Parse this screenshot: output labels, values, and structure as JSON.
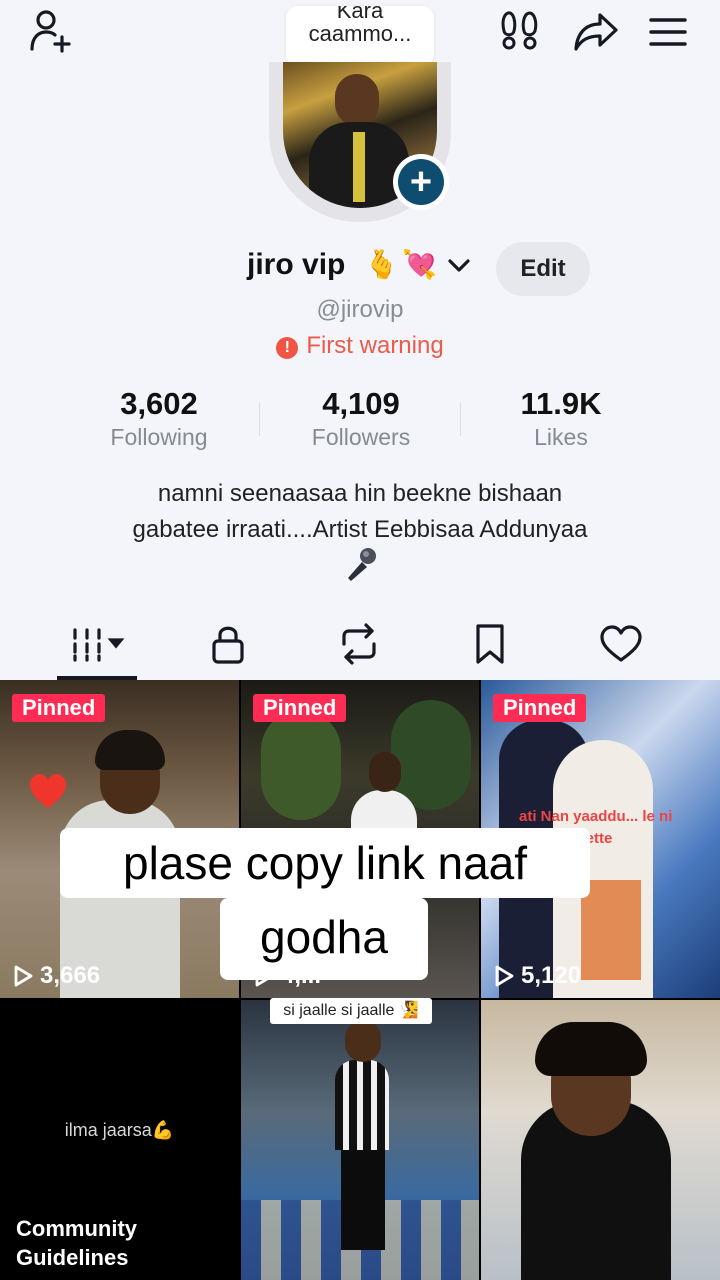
{
  "topbar": {
    "icons": [
      "add-friend-icon",
      "footprints-icon",
      "share-icon",
      "menu-icon"
    ]
  },
  "note": {
    "line1": "Kara",
    "line2": "caammo..."
  },
  "profile": {
    "name": "jiro vip",
    "emoji_hand": "🫰",
    "emoji_heart": "💘",
    "edit_label": "Edit",
    "handle": "@jirovip",
    "warning": "First warning",
    "warning_icon": "!",
    "bio_line1": "namni seenaasaa hin beekne bishaan",
    "bio_line2": "gabatee irraati....Artist Eebbisaa Addunyaa",
    "bio_emoji": "microphone-icon"
  },
  "stats": [
    {
      "value": "3,602",
      "label": "Following"
    },
    {
      "value": "4,109",
      "label": "Followers"
    },
    {
      "value": "11.9K",
      "label": "Likes"
    }
  ],
  "tabs": [
    "videos-grid-icon",
    "lock-icon",
    "repost-icon",
    "bookmark-icon",
    "heart-outline-icon"
  ],
  "videos": [
    {
      "pinned": "Pinned",
      "views": "3,666"
    },
    {
      "pinned": "Pinned",
      "views": "4,..."
    },
    {
      "pinned": "Pinned",
      "views": "5,120",
      "caption": "ati Nan yaaddu... le ni dhuffa ...jette"
    },
    {
      "text": "ilma jaarsa💪",
      "footer_line1": "Community",
      "footer_line2": "Guidelines"
    },
    {
      "caption": "si jaalle si jaalle 🧏"
    },
    {}
  ],
  "overlay": {
    "line1": "plase copy link naaf",
    "line2": "godha"
  },
  "colors": {
    "background": "#f3f5fa",
    "pinned": "#fe2c55",
    "warning": "#ec5a4a",
    "avatar_badge": "#0f4d70"
  }
}
